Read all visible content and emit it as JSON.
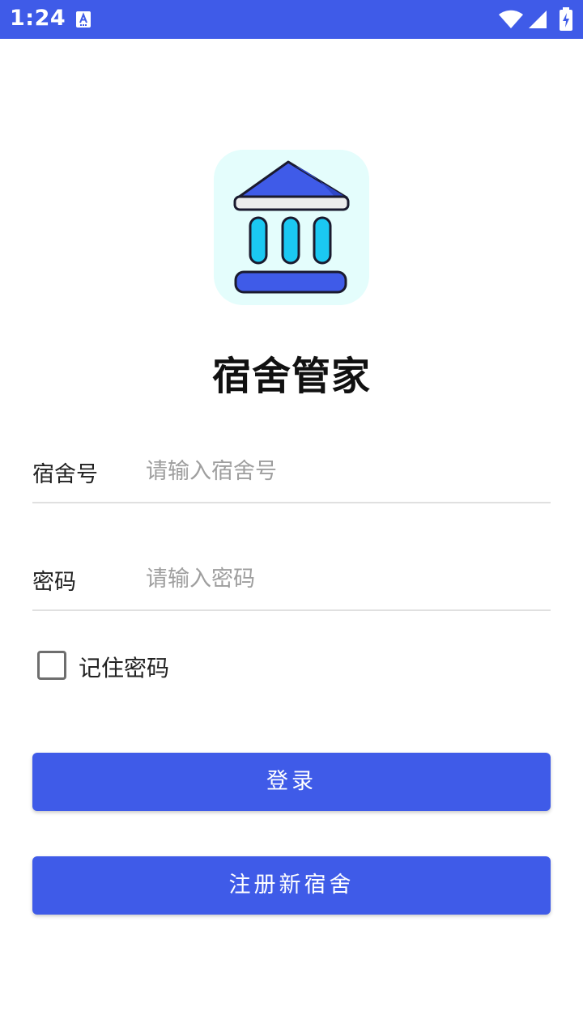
{
  "status_bar": {
    "time": "1:24",
    "background_color": "#3F5BE8",
    "icons": [
      "notification-a-icon",
      "wifi-icon",
      "cell-signal-icon",
      "battery-charging-icon"
    ]
  },
  "app": {
    "title": "宿舍管家",
    "logo_icon": "building-pillars-icon",
    "accent_color": "#3F5BE8",
    "logo_bg_color": "#E4FDFC"
  },
  "form": {
    "dorm": {
      "label": "宿舍号",
      "placeholder": "请输入宿舍号",
      "value": ""
    },
    "password": {
      "label": "密码",
      "placeholder": "请输入密码",
      "value": ""
    },
    "remember": {
      "label": "记住密码",
      "checked": false
    }
  },
  "buttons": {
    "login": "登录",
    "register": "注册新宿舍"
  }
}
